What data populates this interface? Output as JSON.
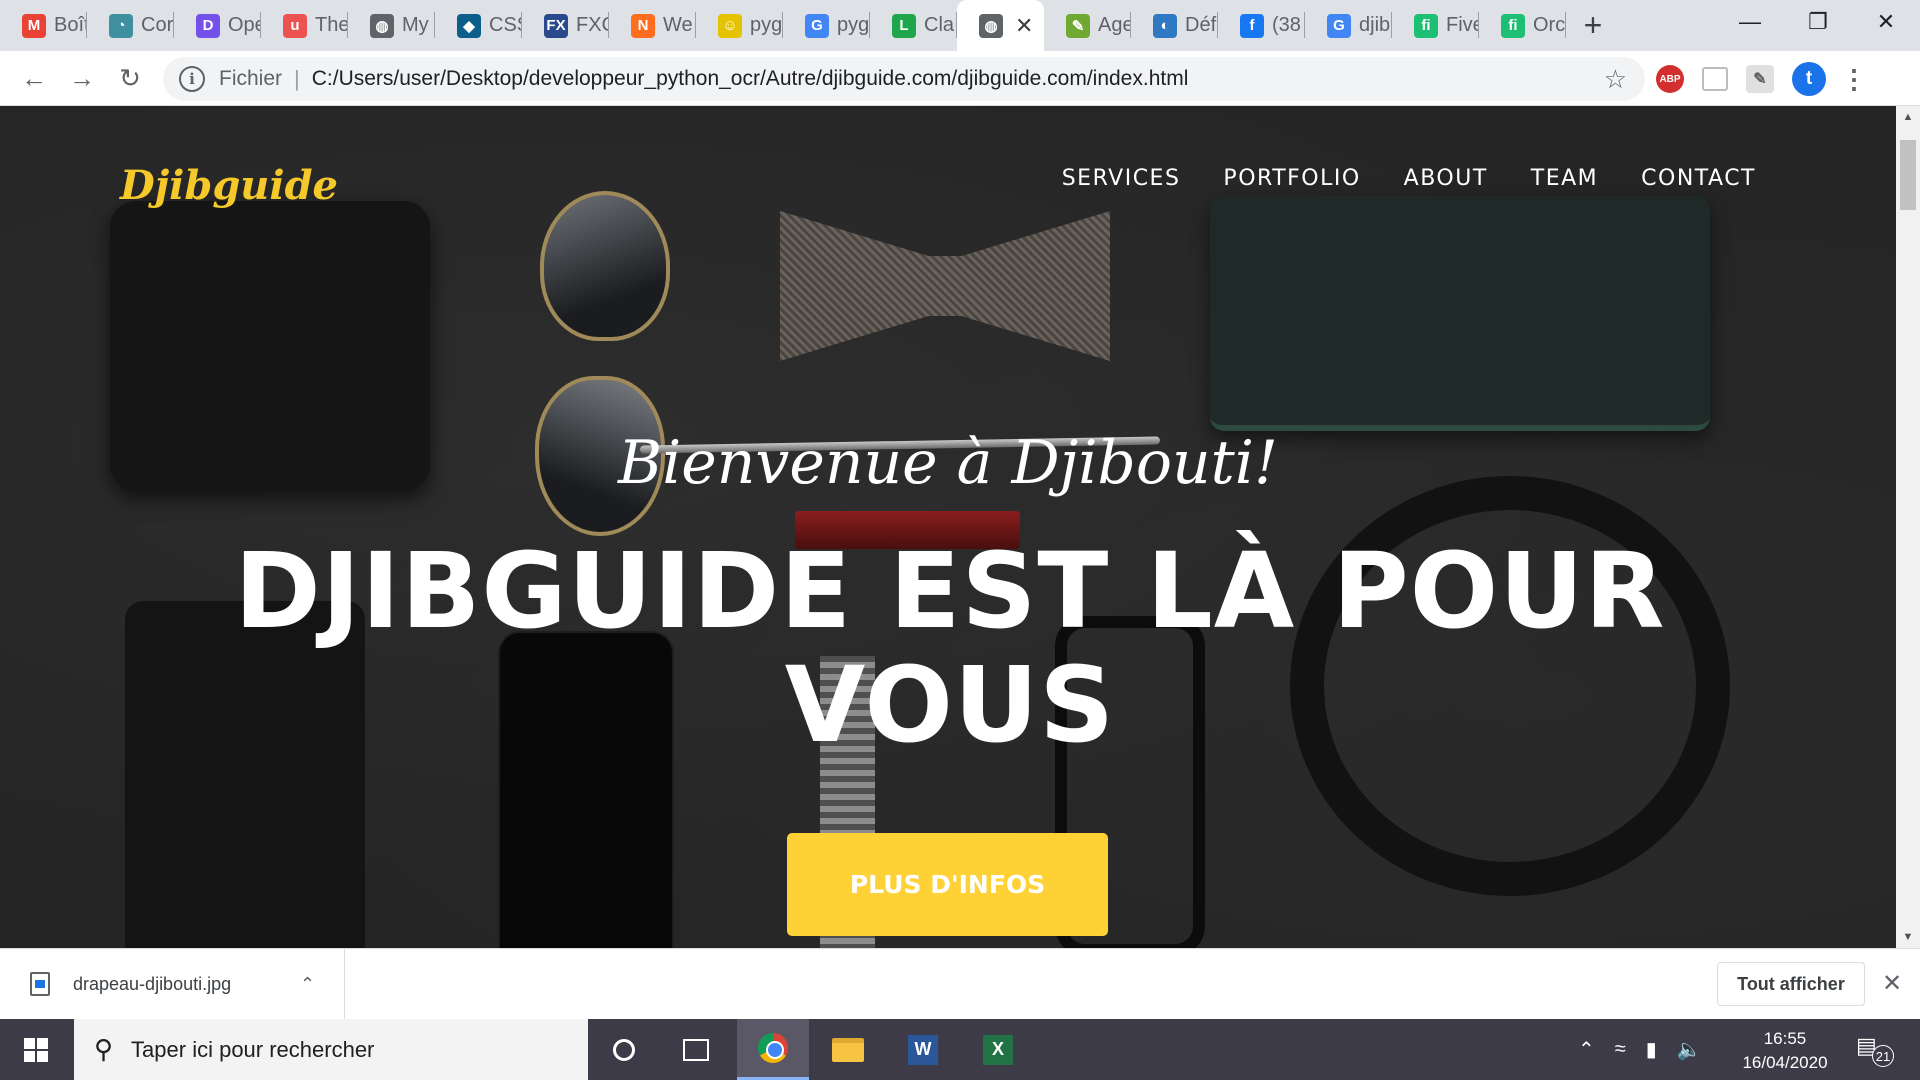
{
  "browser": {
    "tabs": [
      {
        "label": "Boît",
        "icon": "gmail-icon",
        "color": "#ea4335",
        "glyph": "M"
      },
      {
        "label": "Cor",
        "icon": "thread-icon",
        "color": "#3f8fa0",
        "glyph": "◔"
      },
      {
        "label": "Ope",
        "icon": "openclassrooms-icon",
        "color": "#7451eb",
        "glyph": "D"
      },
      {
        "label": "The",
        "icon": "udemy-icon",
        "color": "#ec5252",
        "glyph": "u"
      },
      {
        "label": "My",
        "icon": "globe-icon",
        "color": "#5f6368",
        "glyph": "◍"
      },
      {
        "label": "CSS",
        "icon": "css-icon",
        "color": "#0b5f8a",
        "glyph": "◆"
      },
      {
        "label": "FXC",
        "icon": "fx-icon",
        "color": "#2b4a8e",
        "glyph": "FX"
      },
      {
        "label": "We",
        "icon": "web-icon",
        "color": "#ff6d1f",
        "glyph": "N"
      },
      {
        "label": "pyg",
        "icon": "pygame-icon",
        "color": "#e6c300",
        "glyph": "☺"
      },
      {
        "label": "pyg",
        "icon": "google-icon",
        "color": "#4285f4",
        "glyph": "G"
      },
      {
        "label": "Cla",
        "icon": "l-icon",
        "color": "#1ea74a",
        "glyph": "L"
      },
      {
        "label": "",
        "icon": "globe-icon",
        "color": "#5f6368",
        "glyph": "◍",
        "active": true
      },
      {
        "label": "Age",
        "icon": "leaf-icon",
        "color": "#6fa832",
        "glyph": "✎"
      },
      {
        "label": "Déf",
        "icon": "circle-icon",
        "color": "#2f78c4",
        "glyph": "◐"
      },
      {
        "label": "(38",
        "icon": "facebook-icon",
        "color": "#1877f2",
        "glyph": "f"
      },
      {
        "label": "djib",
        "icon": "google-icon",
        "color": "#4285f4",
        "glyph": "G"
      },
      {
        "label": "Five",
        "icon": "fiverr-icon",
        "color": "#1dbf73",
        "glyph": "fi"
      },
      {
        "label": "Orc",
        "icon": "fiverr-icon",
        "color": "#1dbf73",
        "glyph": "fi"
      }
    ],
    "new_tab": "+",
    "scheme_label": "Fichier",
    "url": "C:/Users/user/Desktop/developpeur_python_ocr/Autre/djibguide.com/djibguide.com/index.html",
    "ext_abp": "ABP",
    "avatar_letter": "t"
  },
  "site": {
    "logo": "Djibguide",
    "nav": [
      "SERVICES",
      "PORTFOLIO",
      "ABOUT",
      "TEAM",
      "CONTACT"
    ],
    "hero_subtitle": "Bienvenue à Djibouti!",
    "hero_title": "DJIBGUIDE EST LÀ POUR VOUS",
    "hero_button": "PLUS D'INFOS",
    "accent_color": "#fed136"
  },
  "downloads": {
    "file_name": "drapeau-djibouti.jpg",
    "show_all": "Tout afficher"
  },
  "taskbar": {
    "search_placeholder": "Taper ici pour rechercher",
    "time": "16:55",
    "date": "16/04/2020",
    "notification_count": "21",
    "apps": [
      "cortana",
      "task-view",
      "chrome",
      "file-explorer",
      "word",
      "excel"
    ]
  }
}
